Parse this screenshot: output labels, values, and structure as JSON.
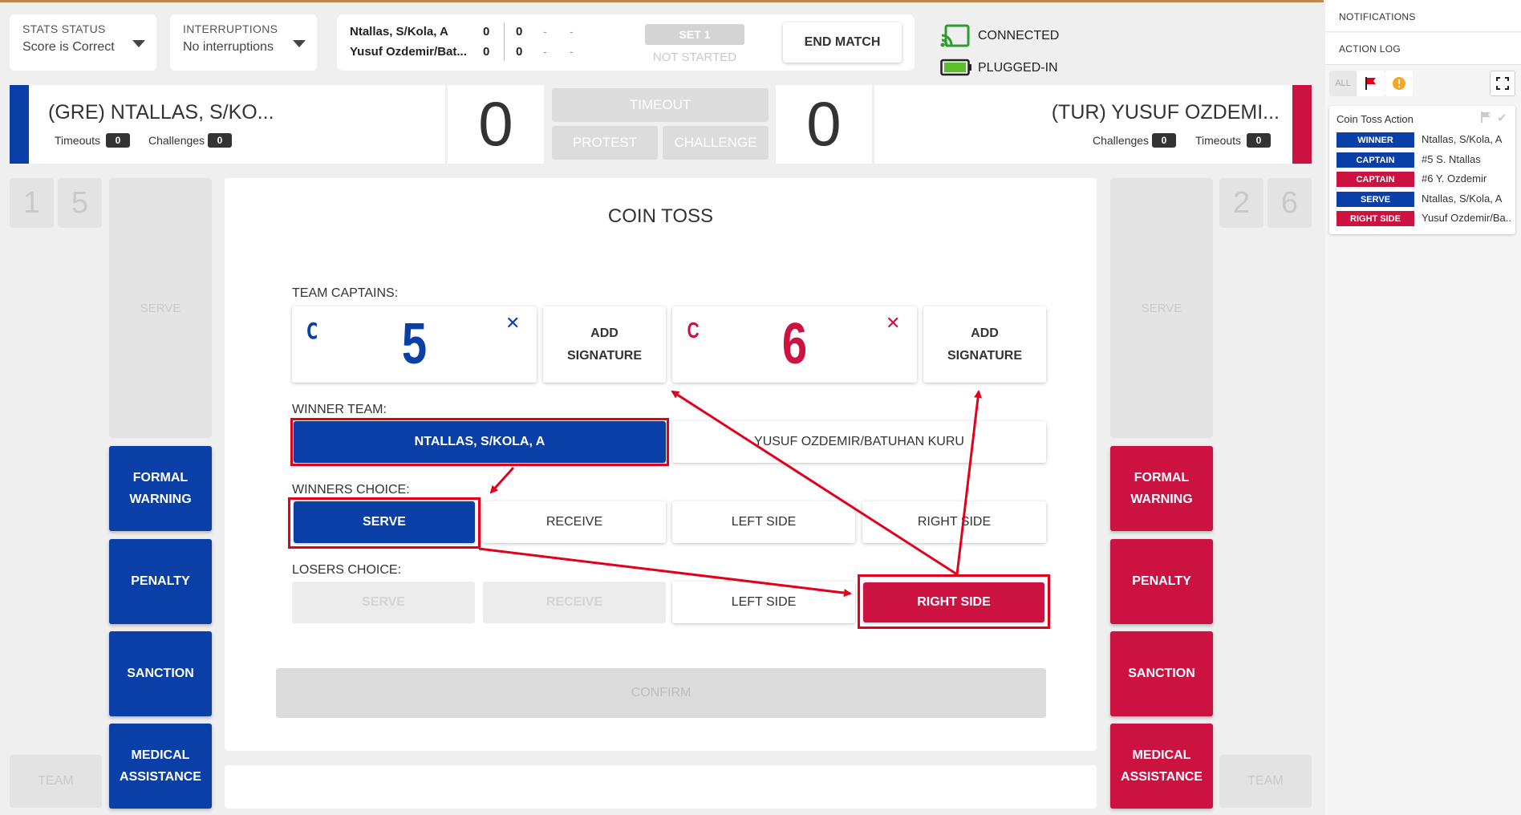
{
  "colors": {
    "team_a": "#0a3fa8",
    "team_b": "#cc1241",
    "annotation": "#e2001a",
    "connected": "#2e9c2e"
  },
  "stats_status": {
    "label": "STATS STATUS",
    "value": "Score is Correct"
  },
  "interruptions": {
    "label": "INTERRUPTIONS",
    "value": "No interruptions"
  },
  "mini_score": {
    "team_a": {
      "name": "Ntallas, S/Kola, A",
      "sets": "0",
      "points": "0",
      "d1": "-",
      "d2": "-"
    },
    "team_b": {
      "name": "Yusuf Ozdemir/Bat...",
      "sets": "0",
      "points": "0",
      "d1": "-",
      "d2": "-"
    }
  },
  "set": {
    "label": "SET 1",
    "status": "NOT STARTED"
  },
  "end_match": "END MATCH",
  "connection": {
    "connected": "CONNECTED",
    "power": "PLUGGED-IN"
  },
  "team_a": {
    "name": "(GRE) NTALLAS, S/KO...",
    "timeouts_label": "Timeouts",
    "timeouts": "0",
    "challenges_label": "Challenges",
    "challenges": "0",
    "score": "0"
  },
  "team_b": {
    "name": "(TUR) YUSUF OZDEMI...",
    "timeouts_label": "Timeouts",
    "timeouts": "0",
    "challenges_label": "Challenges",
    "challenges": "0",
    "score": "0"
  },
  "center_buttons": {
    "timeout": "TIMEOUT",
    "protest": "PROTEST",
    "challenge": "CHALLENGE"
  },
  "left_col": {
    "num1": "1",
    "num2": "5",
    "serve": "SERVE",
    "formal_warning": "FORMAL WARNING",
    "penalty": "PENALTY",
    "sanction": "SANCTION",
    "medical": "MEDICAL ASSISTANCE",
    "team": "TEAM"
  },
  "right_col": {
    "num1": "2",
    "num2": "6",
    "serve": "SERVE",
    "formal_warning": "FORMAL WARNING",
    "penalty": "PENALTY",
    "sanction": "SANCTION",
    "medical": "MEDICAL ASSISTANCE",
    "team": "TEAM"
  },
  "coin_toss": {
    "title": "COIN TOSS",
    "captains_label": "TEAM CAPTAINS:",
    "captain_a": {
      "mark": "C",
      "number": "5"
    },
    "captain_b": {
      "mark": "C",
      "number": "6"
    },
    "add_signature_line1": "ADD",
    "add_signature_line2": "SIGNATURE",
    "winner_team_label": "WINNER TEAM:",
    "winner_options": [
      "NTALLAS, S/KOLA, A",
      "YUSUF OZDEMIR/BATUHAN KURU"
    ],
    "winners_choice_label": "WINNERS CHOICE:",
    "losers_choice_label": "LOSERS CHOICE:",
    "choices": [
      "SERVE",
      "RECEIVE",
      "LEFT SIDE",
      "RIGHT SIDE"
    ],
    "confirm": "CONFIRM"
  },
  "right_panel": {
    "notifications": "NOTIFICATIONS",
    "action_log": "ACTION LOG",
    "filter_all": "ALL",
    "card_title": "Coin Toss Action",
    "rows": [
      {
        "tag": "WINNER",
        "value": "Ntallas, S/Kola, A",
        "team": "a"
      },
      {
        "tag": "CAPTAIN",
        "value": "#5 S. Ntallas",
        "team": "a"
      },
      {
        "tag": "CAPTAIN",
        "value": "#6 Y. Ozdemir",
        "team": "b"
      },
      {
        "tag": "SERVE",
        "value": "Ntallas, S/Kola, A",
        "team": "a"
      },
      {
        "tag": "RIGHT SIDE",
        "value": "Yusuf Ozdemir/Ba...",
        "team": "b"
      }
    ]
  }
}
